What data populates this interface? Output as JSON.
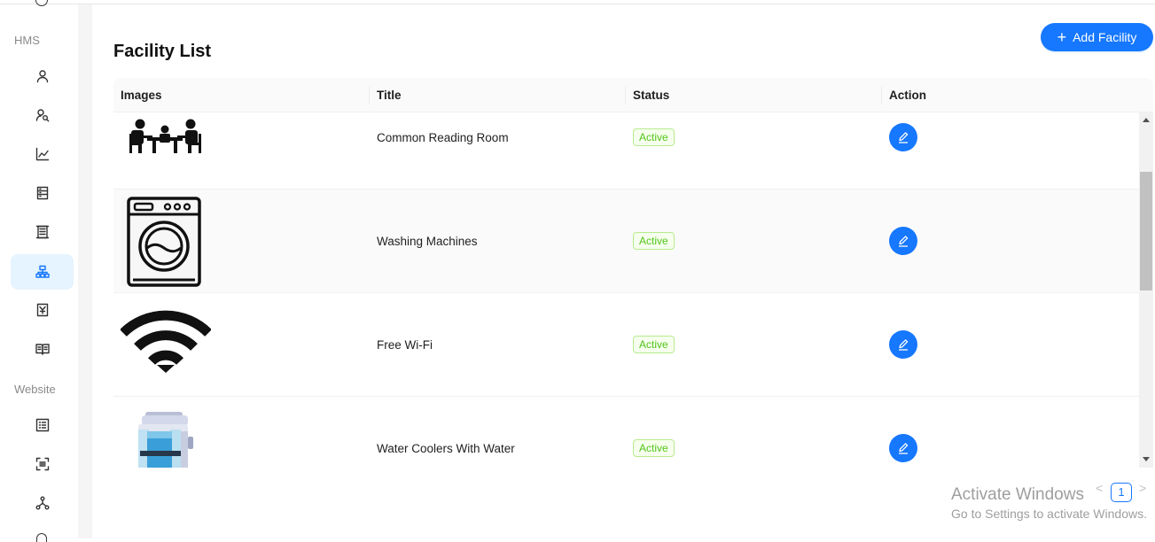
{
  "sidebar": {
    "section_hms": "HMS",
    "section_website": "Website",
    "hms_items": [
      {
        "icon": "user-icon"
      },
      {
        "icon": "users-search-icon"
      },
      {
        "icon": "line-chart-icon"
      },
      {
        "icon": "database-icon"
      },
      {
        "icon": "building-icon"
      },
      {
        "icon": "cluster-icon",
        "active": true
      },
      {
        "icon": "voucher-icon"
      },
      {
        "icon": "book-icon"
      }
    ],
    "website_items": [
      {
        "icon": "list-icon"
      },
      {
        "icon": "scan-icon"
      },
      {
        "icon": "share-nodes-icon"
      }
    ]
  },
  "page": {
    "title": "Facility List",
    "add_button_label": "Add Facility"
  },
  "table": {
    "columns": [
      "Images",
      "Title",
      "Status",
      "Action"
    ],
    "rows": [
      {
        "image": "reading-room-icon",
        "title": "Common Reading Room",
        "status": "Active"
      },
      {
        "image": "washing-machine-icon",
        "title": "Washing Machines",
        "status": "Active"
      },
      {
        "image": "wifi-icon",
        "title": "Free Wi-Fi",
        "status": "Active"
      },
      {
        "image": "water-cooler-icon",
        "title": "Water Coolers With Water",
        "status": "Active"
      }
    ]
  },
  "pagination": {
    "current_page": "1",
    "prev_symbol": "<",
    "next_symbol": ">"
  },
  "watermark": {
    "line1": "Activate Windows",
    "line2": "Go to Settings to activate Windows."
  },
  "colors": {
    "primary": "#1677ff",
    "active_bg": "#e6f4ff",
    "tag_green": "#52c41a"
  }
}
